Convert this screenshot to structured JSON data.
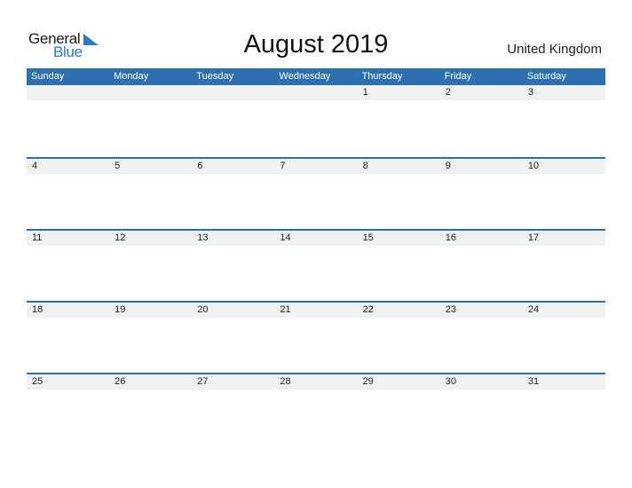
{
  "logo": {
    "line1": "General",
    "line2": "Blue"
  },
  "title": "August 2019",
  "country": "United Kingdom",
  "colors": {
    "header_bg": "#2e6fb0",
    "date_strip_bg": "#f1f1f1",
    "logo_blue": "#2a7bc4"
  },
  "weekdays": [
    "Sunday",
    "Monday",
    "Tuesday",
    "Wednesday",
    "Thursday",
    "Friday",
    "Saturday"
  ],
  "weeks": [
    [
      "",
      "",
      "",
      "",
      "1",
      "2",
      "3"
    ],
    [
      "4",
      "5",
      "6",
      "7",
      "8",
      "9",
      "10"
    ],
    [
      "11",
      "12",
      "13",
      "14",
      "15",
      "16",
      "17"
    ],
    [
      "18",
      "19",
      "20",
      "21",
      "22",
      "23",
      "24"
    ],
    [
      "25",
      "26",
      "27",
      "28",
      "29",
      "30",
      "31"
    ]
  ]
}
